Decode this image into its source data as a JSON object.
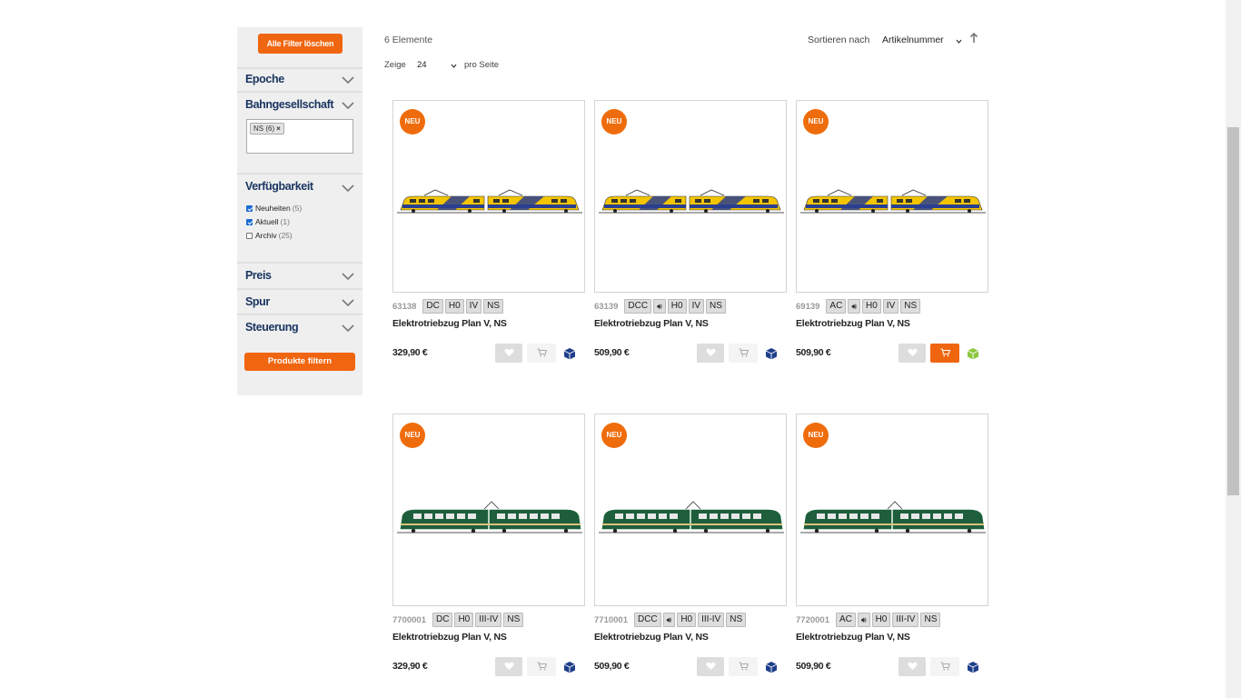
{
  "sidebar": {
    "clear_filters": "Alle Filter löschen",
    "facets": {
      "epoche": "Epoche",
      "bahngesellschaft": "Bahngesellschaft",
      "verfuegbarkeit": "Verfügbarkeit",
      "preis": "Preis",
      "spur": "Spur",
      "steuerung": "Steuerung"
    },
    "selected_tag": "NS (6)",
    "availability": [
      {
        "label": "Neuheiten",
        "count": "(5)",
        "checked": true
      },
      {
        "label": "Aktuell",
        "count": "(1)",
        "checked": true
      },
      {
        "label": "Archiv",
        "count": "(25)",
        "checked": false
      }
    ],
    "apply_filters": "Produkte filtern"
  },
  "toolbar": {
    "count": "6 Elemente",
    "show_label": "Zeige",
    "per_page_value": "24",
    "per_page_label": "pro Seite",
    "sort_label": "Sortieren nach",
    "sort_value": "Artikelnummer"
  },
  "products": [
    {
      "badge": "NEU",
      "artno": "63138",
      "chips": [
        "DC",
        "H0",
        "IV",
        "NS"
      ],
      "name": "Elektrotriebzug Plan V, NS",
      "price": "329,90 €",
      "train": "yellow",
      "cart_active": false,
      "stock": "blue"
    },
    {
      "badge": "NEU",
      "artno": "63139",
      "chips": [
        "DCC",
        "sound",
        "H0",
        "IV",
        "NS"
      ],
      "name": "Elektrotriebzug Plan V, NS",
      "price": "509,90 €",
      "train": "yellow",
      "cart_active": false,
      "stock": "blue"
    },
    {
      "badge": "NEU",
      "artno": "69139",
      "chips": [
        "AC",
        "sound",
        "H0",
        "IV",
        "NS"
      ],
      "name": "Elektrotriebzug Plan V, NS",
      "price": "509,90 €",
      "train": "yellow",
      "cart_active": true,
      "stock": "green"
    },
    {
      "badge": "NEU",
      "artno": "7700001",
      "chips": [
        "DC",
        "H0",
        "III-IV",
        "NS"
      ],
      "name": "Elektrotriebzug Plan V, NS",
      "price": "329,90 €",
      "train": "green",
      "cart_active": false,
      "stock": "blue"
    },
    {
      "badge": "NEU",
      "artno": "7710001",
      "chips": [
        "DCC",
        "sound",
        "H0",
        "III-IV",
        "NS"
      ],
      "name": "Elektrotriebzug Plan V, NS",
      "price": "509,90 €",
      "train": "green",
      "cart_active": false,
      "stock": "blue"
    },
    {
      "badge": "NEU",
      "artno": "7720001",
      "chips": [
        "AC",
        "sound",
        "H0",
        "III-IV",
        "NS"
      ],
      "name": "Elektrotriebzug Plan V, NS",
      "price": "509,90 €",
      "train": "green",
      "cart_active": false,
      "stock": "blue"
    }
  ],
  "colors": {
    "accent": "#f0650f",
    "facet_title": "#1a3560",
    "stock_blue": "#1f3f8a",
    "stock_green": "#8dc63f"
  }
}
